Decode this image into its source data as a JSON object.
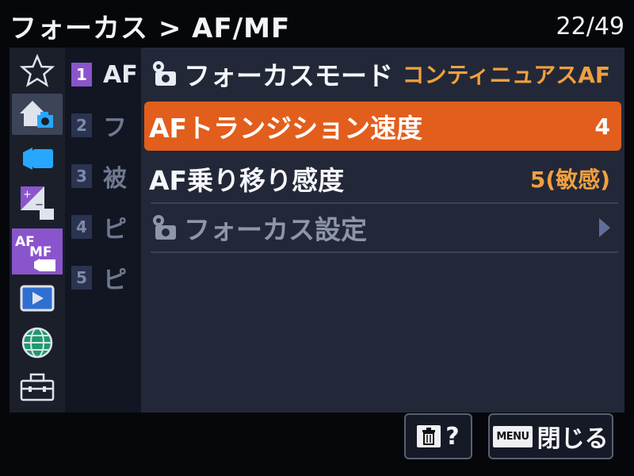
{
  "header": {
    "title": "フォーカス > AF/MF",
    "page_counter": "22/49"
  },
  "categories": [
    {
      "name": "my-menu",
      "icon": "star-icon",
      "color": "#2a2f3f",
      "selected": false
    },
    {
      "name": "shooting",
      "icon": "camera-home-icon",
      "color": "#27a7ff",
      "selected": true
    },
    {
      "name": "video",
      "icon": "video-camera-icon",
      "color": "#1f7fd0",
      "selected": false
    },
    {
      "name": "exposure-color",
      "icon": "exposure-icon",
      "color": "#8a55cc",
      "selected": false
    },
    {
      "name": "af-mf",
      "icon": "af-mf-icon",
      "label": "AF MF",
      "color": "#8a55cc",
      "selected": true
    },
    {
      "name": "playback",
      "icon": "playback-icon",
      "color": "#2f6fd0",
      "selected": false
    },
    {
      "name": "network",
      "icon": "globe-icon",
      "color": "#1f9a6a",
      "selected": false
    },
    {
      "name": "setup",
      "icon": "toolbox-icon",
      "color": "#2a2f3f",
      "selected": false
    }
  ],
  "subpages": [
    {
      "num": "1",
      "text": "AF",
      "active": true
    },
    {
      "num": "2",
      "text": "フ",
      "active": false
    },
    {
      "num": "3",
      "text": "被",
      "active": false
    },
    {
      "num": "4",
      "text": "ピ",
      "active": false
    },
    {
      "num": "5",
      "text": "ピ",
      "active": false
    }
  ],
  "menu": {
    "items": [
      {
        "label": "フォーカスモード",
        "value": "コンティニュアスAF",
        "icon": "camera-setting-icon"
      },
      {
        "label": "AFトランジション速度",
        "value": "4",
        "selected": true
      },
      {
        "label": "AF乗り移り感度",
        "value": "5(敏感)"
      },
      {
        "label": "フォーカス設定",
        "value": "",
        "icon": "camera-setting-icon",
        "disabled": true,
        "has_arrow": true
      }
    ]
  },
  "footer": {
    "help_label": "?",
    "menu_key": "MENU",
    "close_label": "閉じる"
  }
}
